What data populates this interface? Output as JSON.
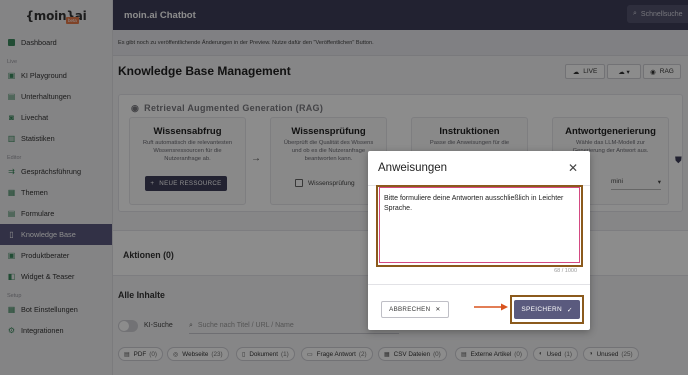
{
  "brand": {
    "logo_text": "{moin}ai",
    "badge": "beta"
  },
  "topbar": {
    "app_title": "moin.ai Chatbot",
    "search_placeholder": "Schnellsuche"
  },
  "preview_notice": "Es gibt noch zu veröffentlichende Änderungen in der Preview. Nutze dafür den \"Veröffentlichen\" Button.",
  "sidebar": {
    "dashboard": "Dashboard",
    "section_live": "Live",
    "ki_playground": "KI Playground",
    "unterhaltungen": "Unterhaltungen",
    "livechat": "Livechat",
    "statistiken": "Statistiken",
    "section_editor": "Editor",
    "gespraechsfuehrung": "Gesprächsführung",
    "themen": "Themen",
    "formulare": "Formulare",
    "knowledge_base": "Knowledge Base",
    "produktberater": "Produktberater",
    "widget": "Widget & Teaser",
    "section_setup": "Setup",
    "bot_einstellungen": "Bot Einstellungen",
    "integrationen": "Integrationen"
  },
  "page": {
    "title": "Knowledge Base Management",
    "live_button": "LIVE",
    "rag_button": "RAG"
  },
  "rag": {
    "title": "Retrieval Augmented Generation (RAG)",
    "card1": {
      "title": "Wissensabfrug",
      "text": "Ruft automatisch die relevantesten Wissensressourcen für die Nutzeranfrage ab.",
      "button": "NEUE RESSOURCE"
    },
    "card2": {
      "title": "Wissensprüfung",
      "text": "Überprüft die Qualität des Wissens und ob es die Nutzeranfrage beantworten kann.",
      "check": "Wissensprüfung"
    },
    "card3": {
      "title": "Instruktionen",
      "text": "Passe die Anweisungen für die"
    },
    "card4": {
      "title": "Antwortgenerierung",
      "text": "Wähle das LLM-Modell zur Generierung der Antwort aus.",
      "select": "mini"
    }
  },
  "aktionen": {
    "title": "Aktionen (0)"
  },
  "alle_inhalte": {
    "title": "Alle Inhalte",
    "ki_suche": "KI-Suche",
    "search_placeholder": "Suche nach Titel / URL / Name",
    "chips": [
      {
        "label": "PDF",
        "count": "(0)"
      },
      {
        "label": "Webseite",
        "count": "(23)"
      },
      {
        "label": "Dokument",
        "count": "(1)"
      },
      {
        "label": "Frage Antwort",
        "count": "(2)"
      },
      {
        "label": "CSV Dateien",
        "count": "(0)"
      },
      {
        "label": "Externe Artikel",
        "count": "(0)"
      },
      {
        "label": "Used",
        "count": "(1)"
      },
      {
        "label": "Unused",
        "count": "(25)"
      }
    ]
  },
  "modal": {
    "title": "Anweisungen",
    "text": "Bitte formuliere deine Antworten ausschließlich in Leichter Sprache.",
    "counter": "68 / 1000",
    "cancel": "ABBRECHEN",
    "save": "SPEICHERN"
  },
  "colors": {
    "accent": "#5a5a7e",
    "topbar": "#3e3e5a",
    "highlight": "#8b5a1c",
    "arrow": "#d9531e"
  }
}
